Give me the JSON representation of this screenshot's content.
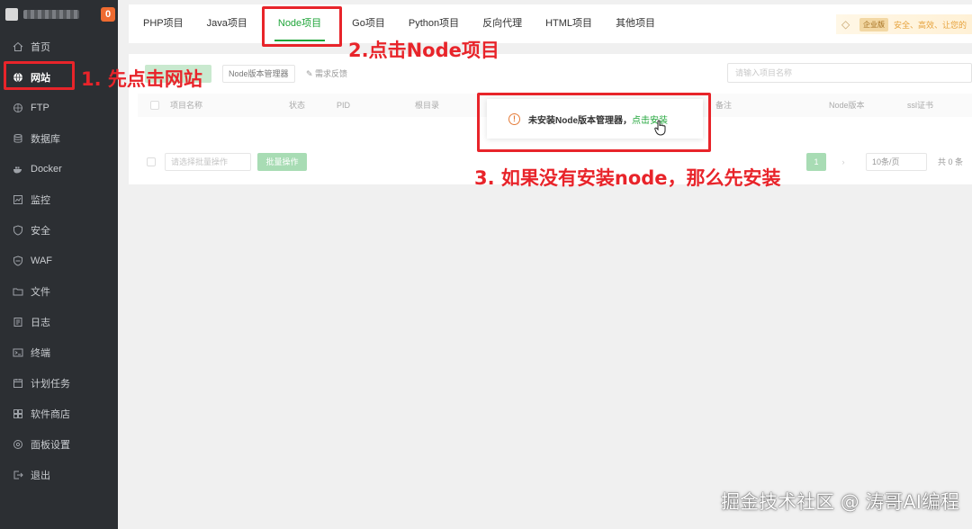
{
  "sidebar": {
    "badge": "0",
    "items": [
      {
        "label": "首页",
        "icon": "home-icon"
      },
      {
        "label": "网站",
        "icon": "globe-icon"
      },
      {
        "label": "FTP",
        "icon": "ftp-icon"
      },
      {
        "label": "数据库",
        "icon": "database-icon"
      },
      {
        "label": "Docker",
        "icon": "docker-icon"
      },
      {
        "label": "监控",
        "icon": "monitor-icon"
      },
      {
        "label": "安全",
        "icon": "shield-icon"
      },
      {
        "label": "WAF",
        "icon": "waf-icon"
      },
      {
        "label": "文件",
        "icon": "folder-icon"
      },
      {
        "label": "日志",
        "icon": "log-icon"
      },
      {
        "label": "终端",
        "icon": "terminal-icon"
      },
      {
        "label": "计划任务",
        "icon": "calendar-icon"
      },
      {
        "label": "软件商店",
        "icon": "store-icon"
      },
      {
        "label": "面板设置",
        "icon": "settings-icon"
      },
      {
        "label": "退出",
        "icon": "logout-icon"
      }
    ]
  },
  "tabs": [
    {
      "label": "PHP项目"
    },
    {
      "label": "Java项目"
    },
    {
      "label": "Node项目"
    },
    {
      "label": "Go项目"
    },
    {
      "label": "Python项目"
    },
    {
      "label": "反向代理"
    },
    {
      "label": "HTML项目"
    },
    {
      "label": "其他项目"
    }
  ],
  "enterprise": {
    "badge": "企业版",
    "slogan": "安全、高效、让您的"
  },
  "toolbar": {
    "node_manager": "Node版本管理器",
    "feedback": "需求反馈",
    "search_placeholder": "请输入项目名称"
  },
  "table": {
    "headers": [
      "项目名称",
      "状态",
      "PID",
      "根目录",
      "备注",
      "Node版本",
      "ssl证书"
    ]
  },
  "pager": {
    "batch_select": "请选择批量操作",
    "batch_button": "批量操作",
    "page": "1",
    "page_size": "10条/页",
    "total": "共 0 条"
  },
  "alert": {
    "message": "未安装Node版本管理器，",
    "link": "点击安装"
  },
  "annotations": {
    "step1": "1. 先点击网站",
    "step2": "2.点击Node项目",
    "step3": "3. 如果没有安装node，那么先安装"
  },
  "watermark": "掘金技术社区 @ 涛哥AI编程",
  "colors": {
    "accent": "#20a53a",
    "annotation_red": "#e8242a",
    "sidebar_bg": "#2c2f33"
  }
}
